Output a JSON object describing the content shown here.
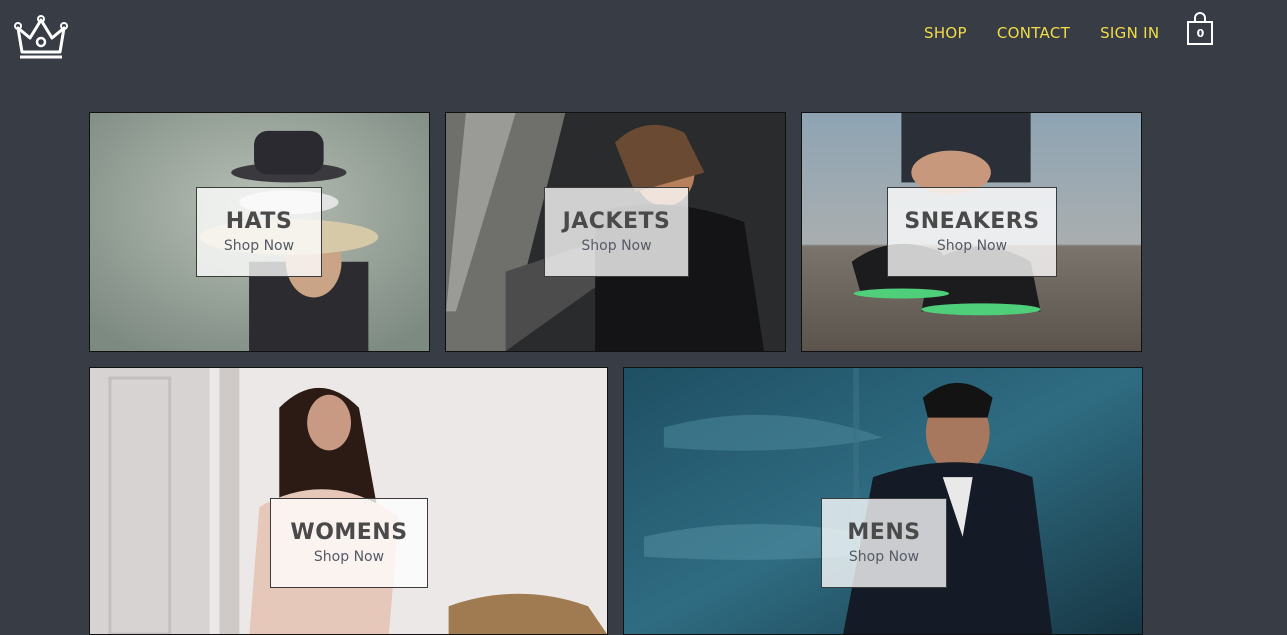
{
  "header": {
    "nav": [
      {
        "label": "SHOP"
      },
      {
        "label": "CONTACT"
      },
      {
        "label": "SIGN IN"
      }
    ],
    "cart_count": "0"
  },
  "colors": {
    "background": "#383c45",
    "nav_text": "#f3dc4a"
  },
  "categories": [
    {
      "title": "HATS",
      "subtitle": "Shop Now"
    },
    {
      "title": "JACKETS",
      "subtitle": "Shop Now"
    },
    {
      "title": "SNEAKERS",
      "subtitle": "Shop Now"
    },
    {
      "title": "WOMENS",
      "subtitle": "Shop Now"
    },
    {
      "title": "MENS",
      "subtitle": "Shop Now"
    }
  ]
}
